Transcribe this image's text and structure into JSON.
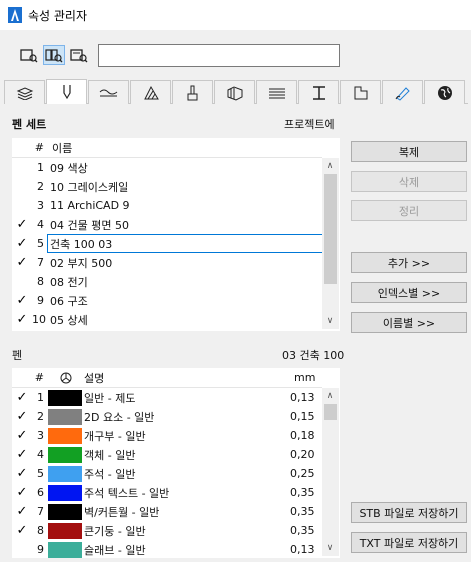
{
  "window": {
    "title": "속성 관리자"
  },
  "tabs": [
    {
      "icon": "layers-icon",
      "active": false
    },
    {
      "icon": "pen-icon",
      "active": true
    },
    {
      "icon": "line-type-icon",
      "active": false
    },
    {
      "icon": "fill-icon",
      "active": false
    },
    {
      "icon": "brush-icon",
      "active": false
    },
    {
      "icon": "composite-icon",
      "active": false
    },
    {
      "icon": "profile-icon",
      "active": false
    },
    {
      "icon": "zone-icon",
      "active": false
    },
    {
      "icon": "surface-icon",
      "active": false
    },
    {
      "icon": "paint-icon",
      "active": false
    },
    {
      "icon": "globe-icon",
      "active": false
    }
  ],
  "pensets": {
    "label": "펜 세트",
    "right_label": "프로젝트에",
    "col_num": "#",
    "col_name": "이름",
    "rows": [
      {
        "check": "",
        "num": "1",
        "name": "09 색상"
      },
      {
        "check": "",
        "num": "2",
        "name": "10 그레이스케일"
      },
      {
        "check": "",
        "num": "3",
        "name": "11 ArchiCAD 9"
      },
      {
        "check": "✓",
        "num": "4",
        "name": "04 건물 평면 50"
      },
      {
        "check": "✓",
        "num": "5",
        "name": "건축 100 03",
        "selected": true
      },
      {
        "check": "✓",
        "num": "7",
        "name": "02 부지 500"
      },
      {
        "check": "",
        "num": "8",
        "name": "08 전기"
      },
      {
        "check": "✓",
        "num": "9",
        "name": "06 구조"
      },
      {
        "check": "✓",
        "num": "10",
        "name": "05 상세"
      }
    ]
  },
  "buttons": {
    "duplicate": "복제",
    "delete": "삭제",
    "cleanup": "정리",
    "add": "추가 >>",
    "by_index": "인덱스별 >>",
    "by_name": "이름별 >>",
    "save_stb": "STB 파일로 저장하기",
    "save_txt": "TXT 파일로 저장하기"
  },
  "pens": {
    "label": "펜",
    "right_label": "03 건축 100",
    "col_num": "#",
    "col_desc": "설명",
    "col_mm": "mm",
    "rows": [
      {
        "check": "✓",
        "num": "1",
        "color": "#000000",
        "desc": "일반 - 제도",
        "mm": "0,13"
      },
      {
        "check": "✓",
        "num": "2",
        "color": "#808080",
        "desc": "2D 요소 - 일반",
        "mm": "0,15"
      },
      {
        "check": "✓",
        "num": "3",
        "color": "#ff6a0d",
        "desc": "개구부 - 일반",
        "mm": "0,18"
      },
      {
        "check": "✓",
        "num": "4",
        "color": "#12a023",
        "desc": "객체 - 일반",
        "mm": "0,20"
      },
      {
        "check": "✓",
        "num": "5",
        "color": "#3fa0f0",
        "desc": "주석 - 일반",
        "mm": "0,25"
      },
      {
        "check": "✓",
        "num": "6",
        "color": "#0015f2",
        "desc": "주석 텍스트 - 일반",
        "mm": "0,35"
      },
      {
        "check": "✓",
        "num": "7",
        "color": "#000000",
        "desc": "벽/커튼월 - 일반",
        "mm": "0,35"
      },
      {
        "check": "✓",
        "num": "8",
        "color": "#a30f0f",
        "desc": "큰기둥 - 일반",
        "mm": "0,35"
      },
      {
        "check": "",
        "num": "9",
        "color": "#3cae9a",
        "desc": "슬래브 - 일반",
        "mm": "0,13"
      }
    ]
  }
}
